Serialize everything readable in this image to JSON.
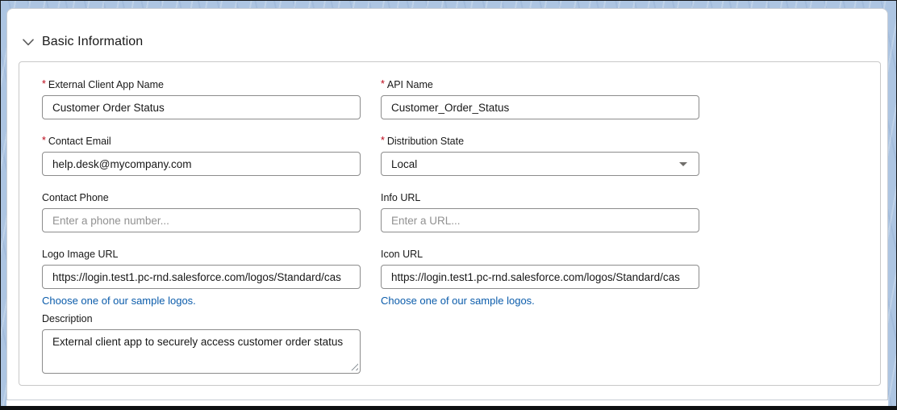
{
  "section": {
    "title": "Basic Information"
  },
  "form": {
    "required_marker": "*",
    "fields": {
      "app_name": {
        "label": "External Client App Name",
        "required": true,
        "value": "Customer Order Status"
      },
      "api_name": {
        "label": "API Name",
        "required": true,
        "value": "Customer_Order_Status"
      },
      "contact_email": {
        "label": "Contact Email",
        "required": true,
        "value": "help.desk@mycompany.com"
      },
      "distribution_state": {
        "label": "Distribution State",
        "required": true,
        "value": "Local",
        "control": "combobox"
      },
      "contact_phone": {
        "label": "Contact Phone",
        "value": "",
        "placeholder": "Enter a phone number..."
      },
      "info_url": {
        "label": "Info URL",
        "value": "",
        "placeholder": "Enter a URL..."
      },
      "logo_url": {
        "label": "Logo Image URL",
        "value": "https://login.test1.pc-rnd.salesforce.com/logos/Standard/cas",
        "link_label": "Choose one of our sample logos."
      },
      "icon_url": {
        "label": "Icon URL",
        "value": "https://login.test1.pc-rnd.salesforce.com/logos/Standard/cas",
        "link_label": "Choose one of our sample logos."
      },
      "description": {
        "label": "Description",
        "value": "External client app to securely access customer order status"
      }
    }
  },
  "colors": {
    "background_blue": "#adc5e2",
    "link_blue": "#0b5cab",
    "required_red": "#ba0517",
    "input_border_gray": "#8c8c8c",
    "fieldset_border_gray": "#c9c9c9"
  }
}
